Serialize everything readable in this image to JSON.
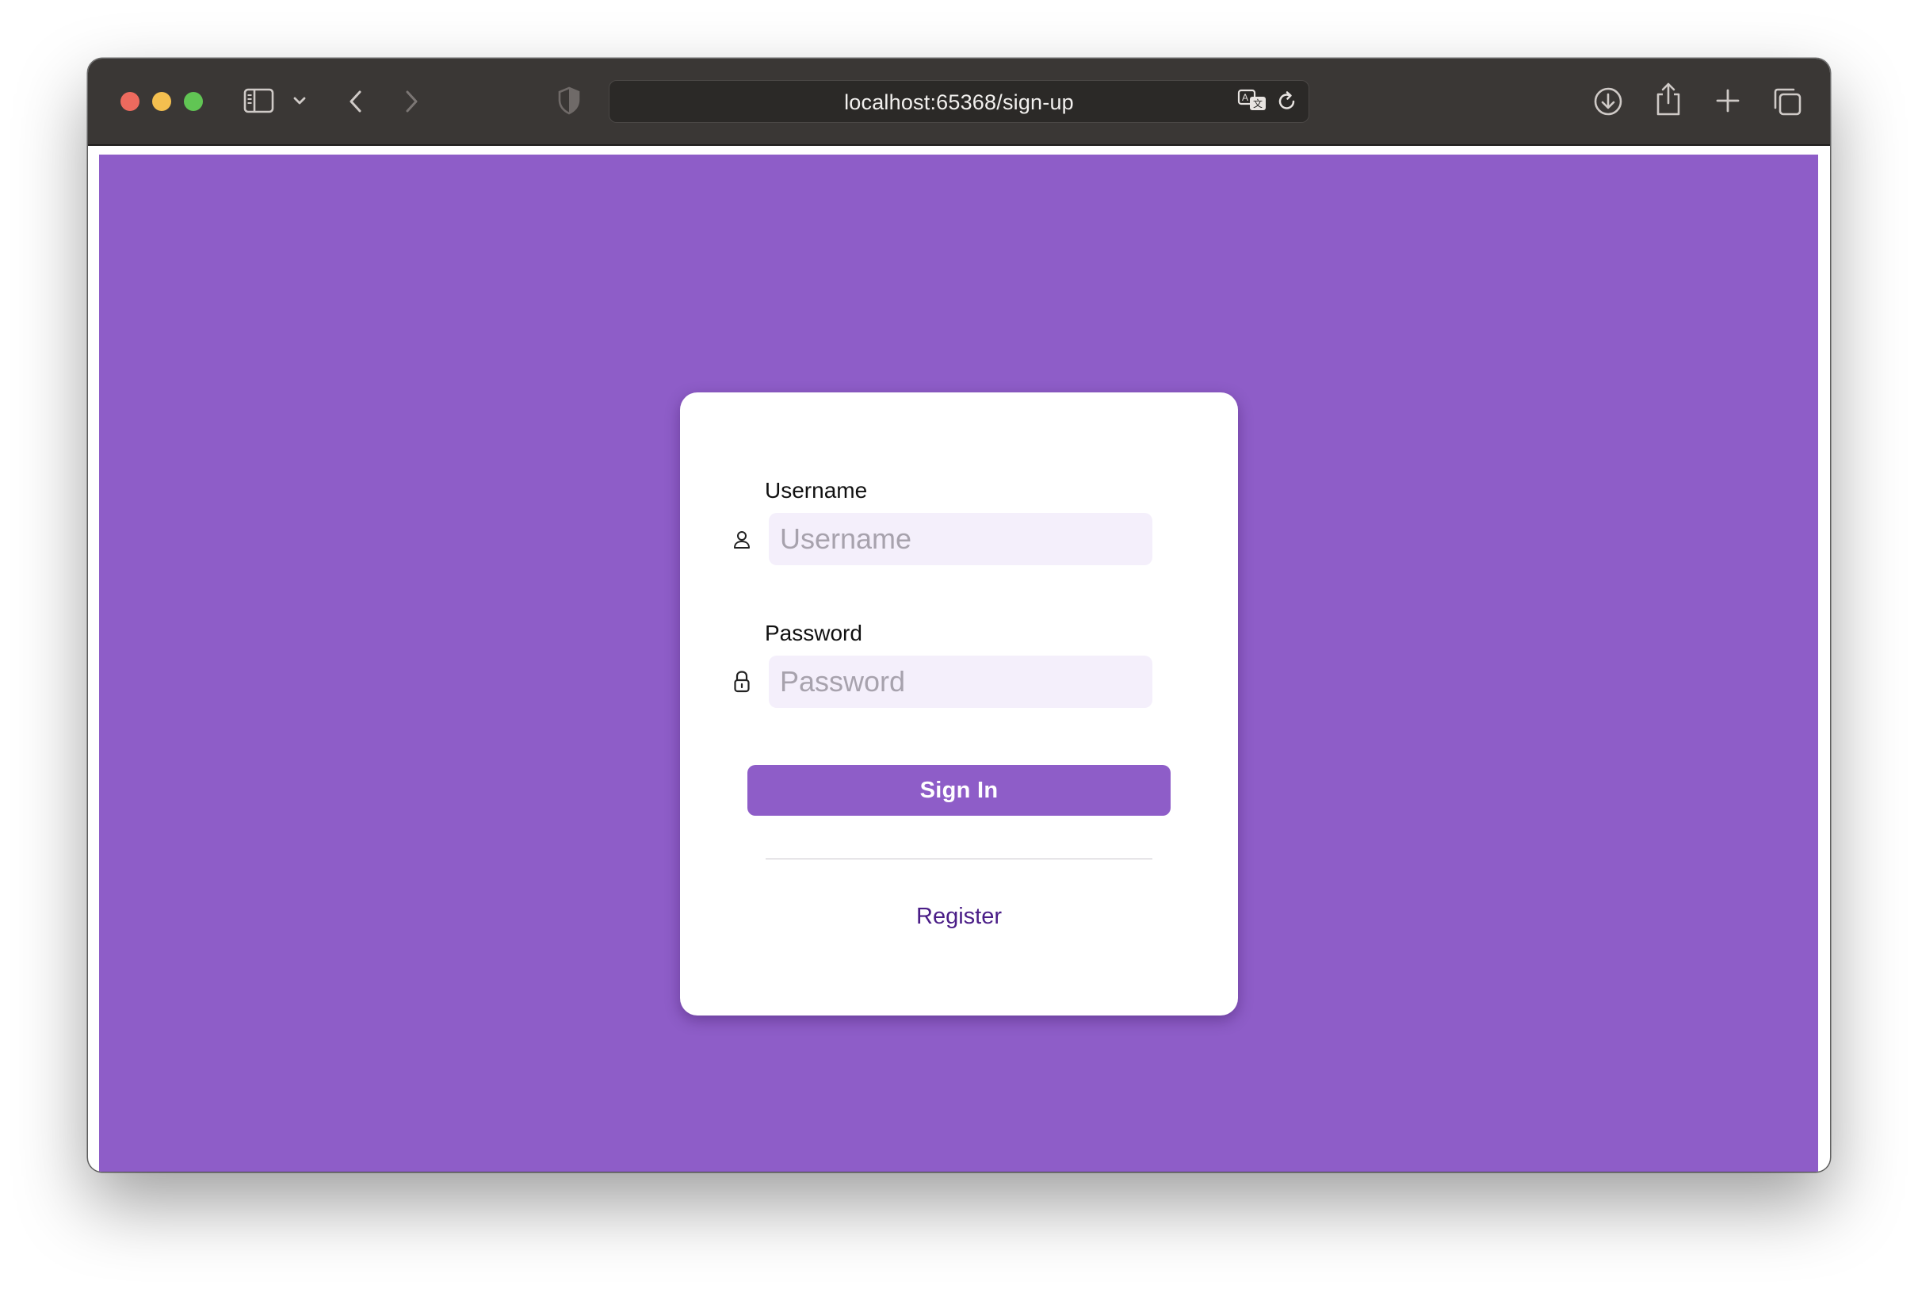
{
  "browser": {
    "url": "localhost:65368/sign-up",
    "colors": {
      "titlebar": "#3a3735",
      "close": "#ed6a5e",
      "minimize": "#f4bf4f",
      "maximize": "#61c554"
    },
    "icons": [
      "sidebar-icon",
      "chevron-down-icon",
      "back-icon",
      "forward-icon",
      "shield-icon",
      "translate-icon",
      "reload-icon",
      "download-icon",
      "share-icon",
      "new-tab-icon",
      "tabs-overview-icon"
    ]
  },
  "page": {
    "background": "#8e5dc8",
    "form": {
      "username_label": "Username",
      "username_placeholder": "Username",
      "username_value": "",
      "password_label": "Password",
      "password_placeholder": "Password",
      "password_value": "",
      "signin_label": "Sign In",
      "register_label": "Register"
    },
    "colors": {
      "accent": "#8e5dc8",
      "input_bg": "#f4effb",
      "link": "#4a1d87"
    }
  }
}
